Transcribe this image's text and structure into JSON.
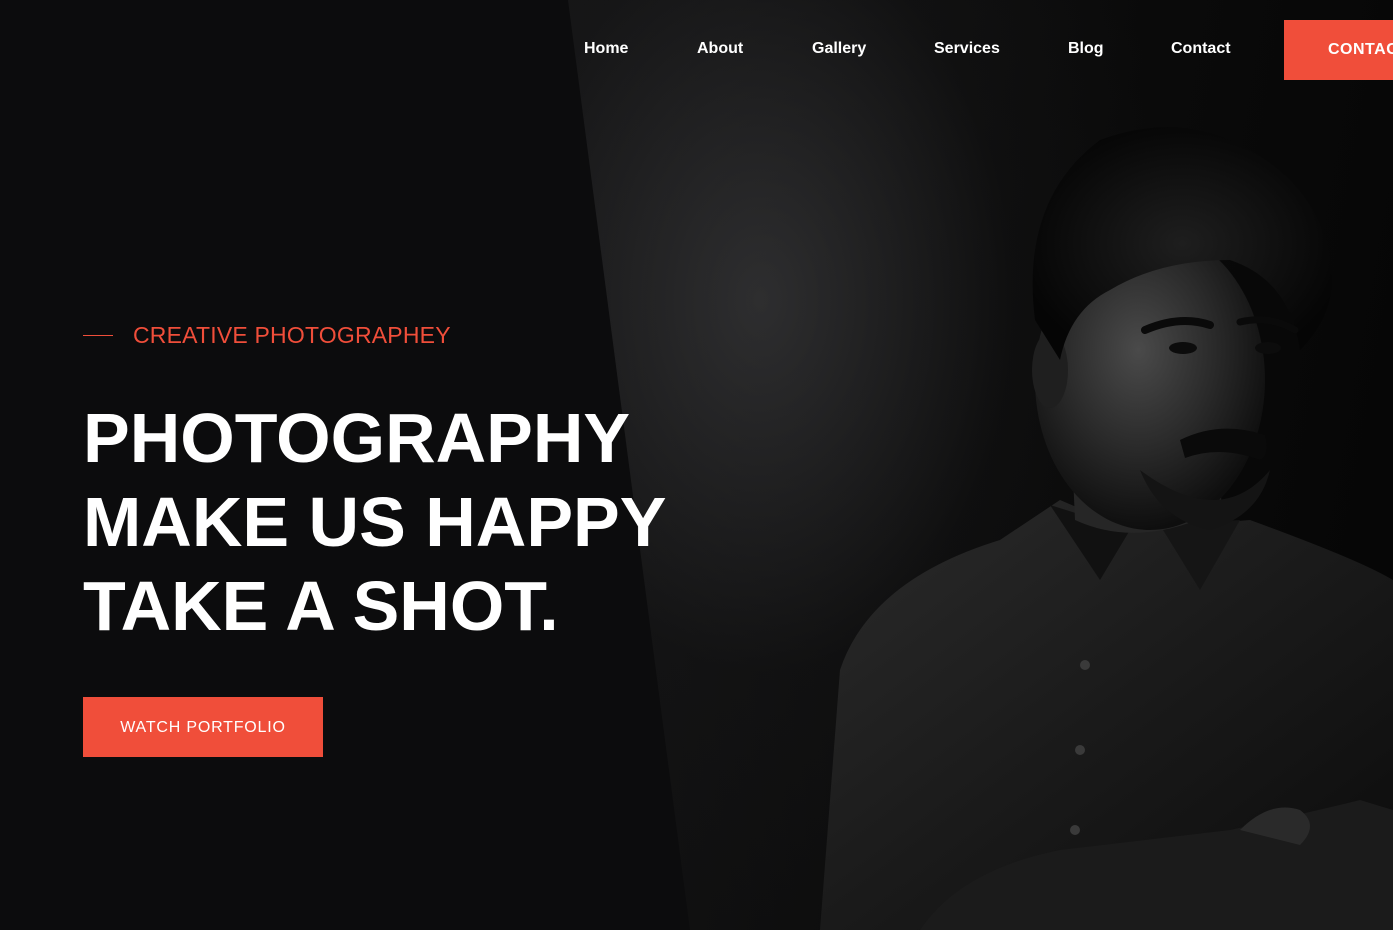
{
  "nav": {
    "items": [
      {
        "label": "Home"
      },
      {
        "label": "About"
      },
      {
        "label": "Gallery"
      },
      {
        "label": "Services"
      },
      {
        "label": "Blog"
      },
      {
        "label": "Contact"
      }
    ],
    "cta_label": "CONTACT"
  },
  "hero": {
    "eyebrow": "CREATIVE PHOTOGRAPHEY",
    "headline_lines": [
      "PHOTOGRAPHY",
      "MAKE US HAPPY",
      "TAKE A SHOT."
    ],
    "button_label": "WATCH PORTFOLIO"
  },
  "colors": {
    "accent": "#f04e3a",
    "background": "#0c0c0d",
    "text": "#ffffff"
  },
  "icons": {
    "hero_image": "portrait-photo"
  }
}
